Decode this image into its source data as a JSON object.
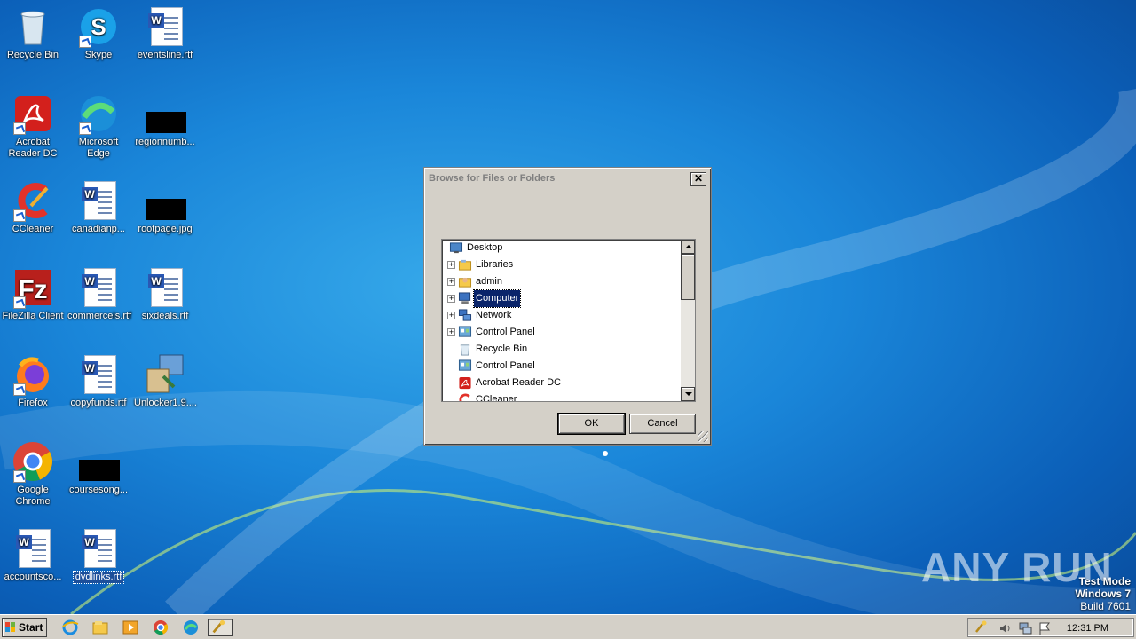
{
  "desktop": {
    "icons": [
      {
        "label": "Recycle Bin",
        "icon": "recycle-bin-icon"
      },
      {
        "label": "Skype",
        "icon": "skype-icon"
      },
      {
        "label": "eventsline.rtf",
        "icon": "word-document-icon"
      },
      {
        "label": "Acrobat Reader DC",
        "icon": "acrobat-reader-icon"
      },
      {
        "label": "Microsoft Edge",
        "icon": "edge-icon"
      },
      {
        "label": "regionnumb...",
        "icon": "redacted-image-icon"
      },
      {
        "label": "CCleaner",
        "icon": "ccleaner-icon"
      },
      {
        "label": "canadianp...",
        "icon": "word-document-icon"
      },
      {
        "label": "rootpage.jpg",
        "icon": "redacted-image-icon"
      },
      {
        "label": "FileZilla Client",
        "icon": "filezilla-icon"
      },
      {
        "label": "commerceis.rtf",
        "icon": "word-document-icon"
      },
      {
        "label": "sixdeals.rtf",
        "icon": "word-document-icon"
      },
      {
        "label": "Firefox",
        "icon": "firefox-icon"
      },
      {
        "label": "copyfunds.rtf",
        "icon": "word-document-icon"
      },
      {
        "label": "Unlocker1.9....",
        "icon": "installer-icon"
      },
      {
        "label": "Google Chrome",
        "icon": "chrome-icon"
      },
      {
        "label": "coursesong...",
        "icon": "redacted-image-icon"
      },
      {
        "label": "accountsco...",
        "icon": "word-document-icon"
      },
      {
        "label": "dvdlinks.rtf",
        "icon": "word-document-icon"
      }
    ]
  },
  "dialog": {
    "title": "Browse for Files or Folders",
    "close_glyph": "✕",
    "tree": [
      {
        "label": "Desktop",
        "icon": "desktop-icon"
      },
      {
        "label": "Libraries",
        "icon": "libraries-icon",
        "expander": "+"
      },
      {
        "label": "admin",
        "icon": "user-folder-icon",
        "expander": "+"
      },
      {
        "label": "Computer",
        "icon": "computer-icon",
        "expander": "+",
        "selected": true
      },
      {
        "label": "Network",
        "icon": "network-icon",
        "expander": "+"
      },
      {
        "label": "Control Panel",
        "icon": "control-panel-icon",
        "expander": "+"
      },
      {
        "label": "Recycle Bin",
        "icon": "recycle-bin-icon"
      },
      {
        "label": "Control Panel",
        "icon": "control-panel-icon"
      },
      {
        "label": "Acrobat Reader DC",
        "icon": "acrobat-reader-icon"
      },
      {
        "label": "CCleaner",
        "icon": "ccleaner-icon"
      }
    ],
    "ok_label": "OK",
    "cancel_label": "Cancel"
  },
  "watermark": {
    "brand": "ANY RUN",
    "test_mode": "Test Mode",
    "os": "Windows 7",
    "build": "Build 7601"
  },
  "taskbar": {
    "start_label": "Start",
    "pinned": [
      "internet-explorer-icon",
      "explorer-icon",
      "media-player-icon",
      "chrome-icon",
      "edge-icon",
      "unlocker-icon"
    ],
    "clock": "12:31 PM"
  },
  "colors": {
    "selection": "#0a246a",
    "dialog_face": "#d4d0c8",
    "desktop_blue": "#1a86d9"
  }
}
